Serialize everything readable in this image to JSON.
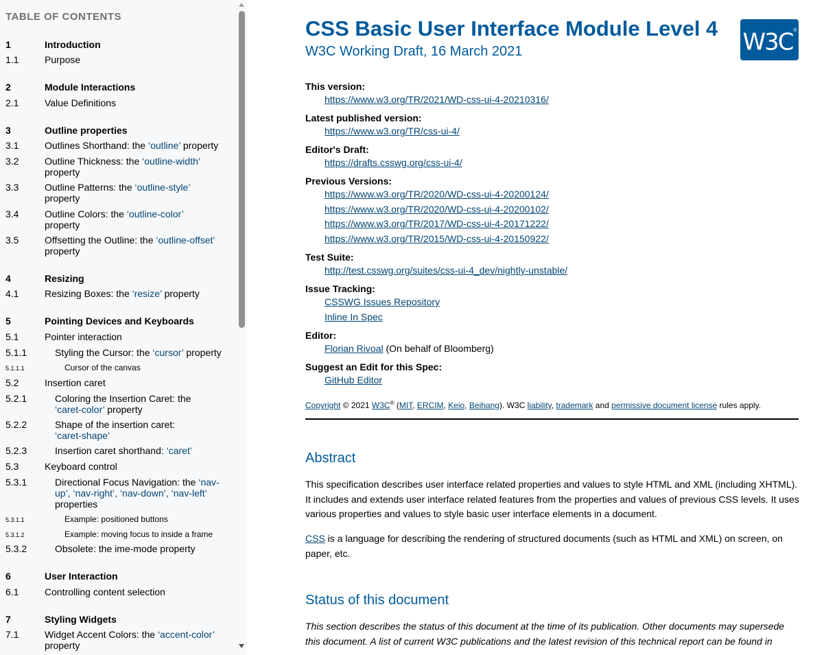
{
  "toc": {
    "title": "TABLE OF CONTENTS",
    "entries": [
      {
        "num": "1",
        "text": "Introduction"
      },
      {
        "num": "1.1",
        "text": "Purpose"
      },
      {
        "num": "2",
        "text": "Module Interactions"
      },
      {
        "num": "2.1",
        "text": "Value Definitions"
      },
      {
        "num": "3",
        "text": "Outline properties"
      },
      {
        "num": "3.1",
        "text": "Outlines Shorthand: the ",
        "prop": "‘outline’",
        "after": " property"
      },
      {
        "num": "3.2",
        "text": "Outline Thickness: the ",
        "prop": "‘outline-width’",
        "after": " property"
      },
      {
        "num": "3.3",
        "text": "Outline Patterns: the ",
        "prop": "‘outline-style’",
        "after": " property"
      },
      {
        "num": "3.4",
        "text": "Outline Colors: the ",
        "prop": "‘outline-color’",
        "after": " property"
      },
      {
        "num": "3.5",
        "text": "Offsetting the Outline: the ",
        "prop": "‘outline-offset’",
        "after": " property"
      },
      {
        "num": "4",
        "text": "Resizing"
      },
      {
        "num": "4.1",
        "text": "Resizing Boxes: the ",
        "prop": "‘resize’",
        "after": " property"
      },
      {
        "num": "5",
        "text": "Pointing Devices and Keyboards"
      },
      {
        "num": "5.1",
        "text": "Pointer interaction"
      },
      {
        "num": "5.1.1",
        "text": "Styling the Cursor: the ",
        "prop": "‘cursor’",
        "after": " property"
      },
      {
        "num": "5.1.1.1",
        "text": "Cursor of the canvas"
      },
      {
        "num": "5.2",
        "text": "Insertion caret"
      },
      {
        "num": "5.2.1",
        "text": "Coloring the Insertion Caret: the ",
        "prop": "‘caret-color’",
        "after": " property"
      },
      {
        "num": "5.2.2",
        "text": "Shape of the insertion caret: ",
        "prop": "‘caret-shape’",
        "after": ""
      },
      {
        "num": "5.2.3",
        "text": "Insertion caret shorthand: ",
        "prop": "‘caret’",
        "after": ""
      },
      {
        "num": "5.3",
        "text": "Keyboard control"
      },
      {
        "num": "5.3.1",
        "text": "Directional Focus Navigation: the ",
        "prop": "‘nav-up’, ‘nav-right’, ‘nav-down’, ‘nav-left’",
        "after": " properties"
      },
      {
        "num": "5.3.1.1",
        "text": "Example: positioned buttons"
      },
      {
        "num": "5.3.1.2",
        "text": "Example: moving focus to inside a frame"
      },
      {
        "num": "5.3.2",
        "text": "Obsolete: the ime-mode property"
      },
      {
        "num": "6",
        "text": "User Interaction"
      },
      {
        "num": "6.1",
        "text": "Controlling content selection"
      },
      {
        "num": "7",
        "text": "Styling Widgets"
      },
      {
        "num": "7.1",
        "text": "Widget Accent Colors: the ",
        "prop": "‘accent-color’",
        "after": " property"
      }
    ]
  },
  "header": {
    "title": "CSS Basic User Interface Module Level 4",
    "subtitle": "W3C Working Draft, 16 March 2021",
    "logo_text": "W3C",
    "logo_mark": "®"
  },
  "meta": {
    "this_version_label": "This version:",
    "this_version": "https://www.w3.org/TR/2021/WD-css-ui-4-20210316/",
    "latest_label": "Latest published version:",
    "latest": "https://www.w3.org/TR/css-ui-4/",
    "editors_draft_label": "Editor's Draft:",
    "editors_draft": "https://drafts.csswg.org/css-ui-4/",
    "previous_label": "Previous Versions:",
    "previous": [
      "https://www.w3.org/TR/2020/WD-css-ui-4-20200124/",
      "https://www.w3.org/TR/2020/WD-css-ui-4-20200102/",
      "https://www.w3.org/TR/2017/WD-css-ui-4-20171222/",
      "https://www.w3.org/TR/2015/WD-css-ui-4-20150922/"
    ],
    "test_suite_label": "Test Suite:",
    "test_suite": "http://test.csswg.org/suites/css-ui-4_dev/nightly-unstable/",
    "issue_label": "Issue Tracking:",
    "issue_repo": "CSSWG Issues Repository",
    "issue_inline": "Inline In Spec",
    "editor_label": "Editor:",
    "editor_name": "Florian Rivoal",
    "editor_affiliation": " (On behalf of Bloomberg)",
    "suggest_label": "Suggest an Edit for this Spec:",
    "suggest_link": "GitHub Editor"
  },
  "copyright": {
    "copyright_link": "Copyright",
    "year": " © 2021 ",
    "w3c": "W3C",
    "reg": "®",
    "open_paren": " (",
    "mit": "MIT",
    "ercim": "ERCIM",
    "keio": "Keio",
    "beihang": "Beihang",
    "mid": "). W3C ",
    "liability": "liability",
    "trademark": "trademark",
    "and": " and ",
    "license": "permissive document license",
    "rules": " rules apply.",
    "comma": ", "
  },
  "abstract": {
    "heading": "Abstract",
    "p1": "This specification describes user interface related properties and values to style HTML and XML (including XHTML). It includes and extends user interface related features from the properties and values of previous CSS levels. It uses various properties and values to style basic user interface elements in a document.",
    "p2_link": "CSS",
    "p2_rest": " is a language for describing the rendering of structured documents (such as HTML and XML) on screen, on paper, etc."
  },
  "status": {
    "heading": "Status of this document",
    "p1": "This section describes the status of this document at the time of its publication. Other documents may supersede this document. A list of current W3C publications and the latest revision of this technical report can be found in"
  },
  "colors": {
    "heading_blue": "#005a9c",
    "link": "#034575",
    "toc_bg": "#f7f8f9"
  }
}
